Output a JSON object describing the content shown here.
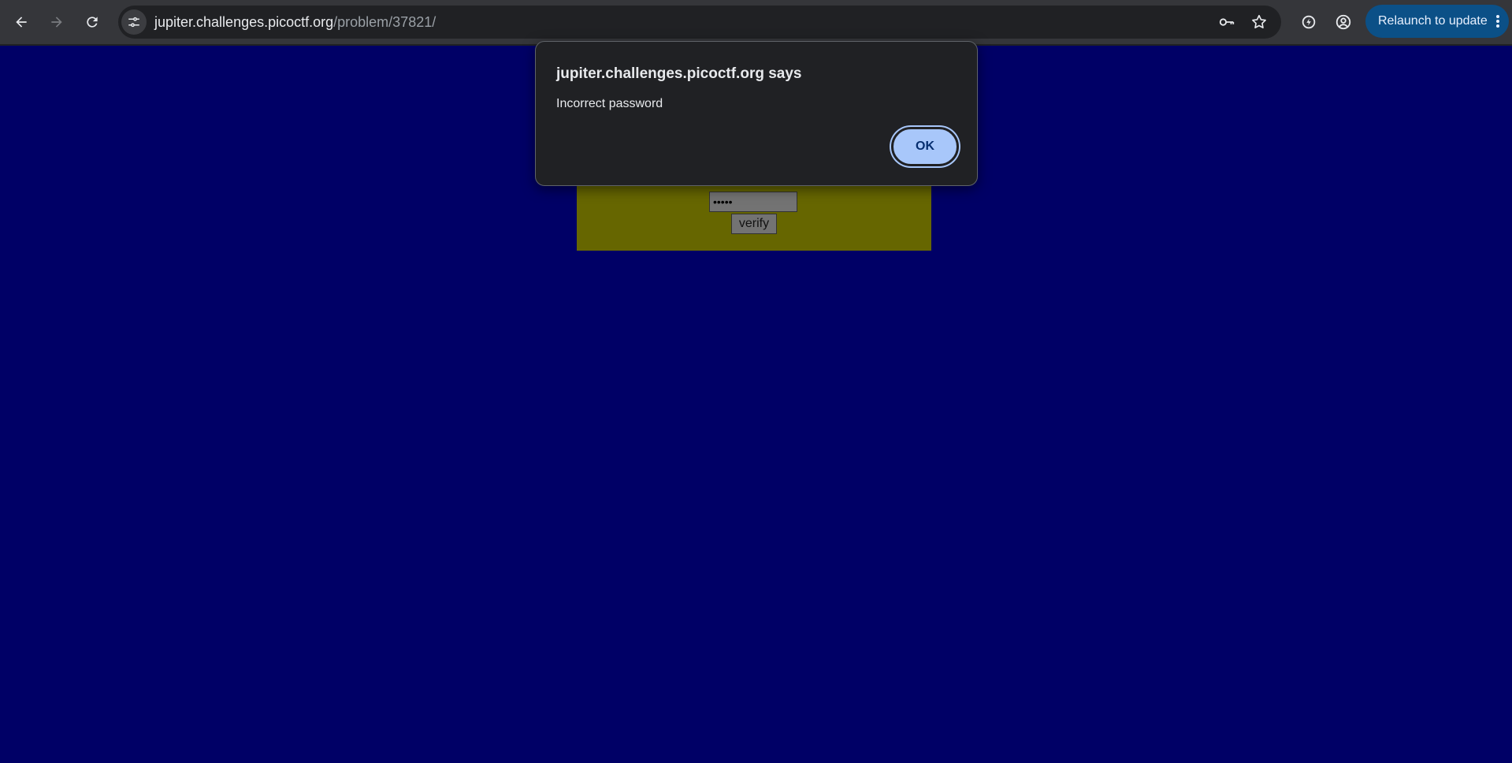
{
  "browser": {
    "url_host": "jupiter.challenges.picoctf.org",
    "url_path": "/problem/37821/",
    "relaunch_label": "Relaunch to update",
    "icons": [
      "back-arrow-icon",
      "forward-arrow-icon",
      "reload-icon",
      "site-settings-icon",
      "password-key-icon",
      "bookmark-star-icon",
      "performance-icon",
      "profile-icon",
      "menu-dots-icon"
    ]
  },
  "page": {
    "background_color": "#000066",
    "panel_color": "#666600",
    "password_value": "•••••",
    "verify_label": "verify"
  },
  "dialog": {
    "title": "jupiter.challenges.picoctf.org says",
    "message": "Incorrect password",
    "ok_label": "OK"
  }
}
